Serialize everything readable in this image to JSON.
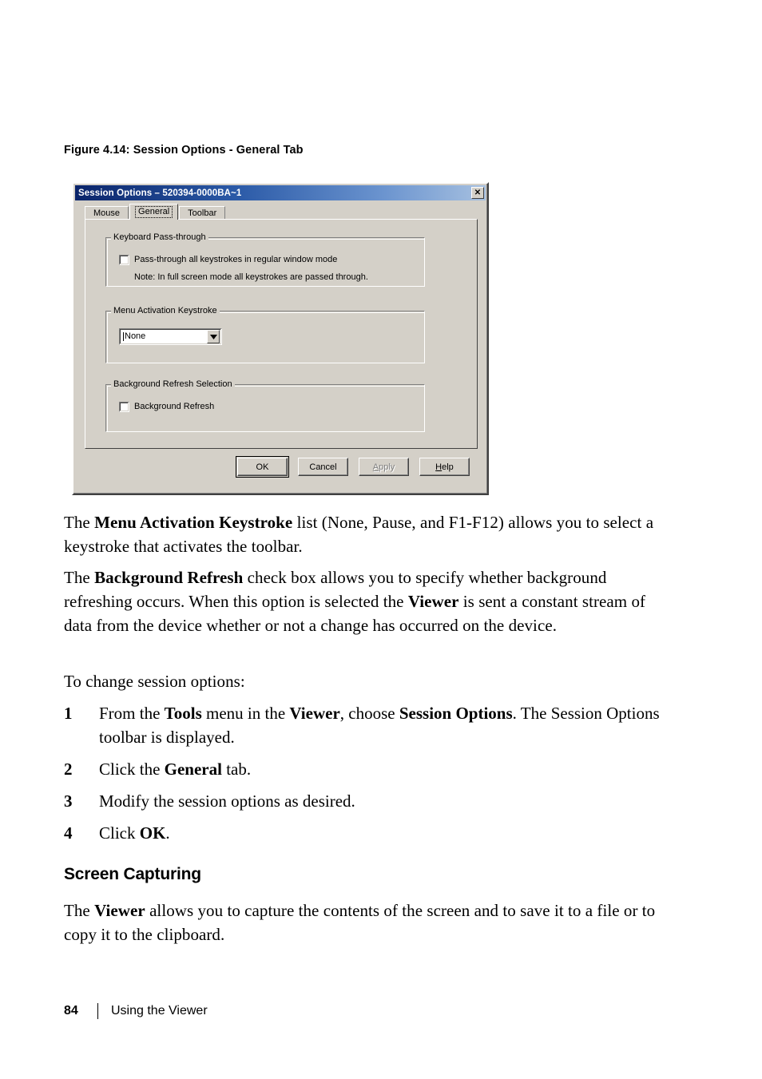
{
  "figure": {
    "caption": "Figure 4.14: Session Options - General Tab"
  },
  "dialog": {
    "title": "Session Options – 520394-0000BA~1",
    "close_label": "✕",
    "tabs": [
      {
        "label": "Mouse",
        "selected": false
      },
      {
        "label": "General",
        "selected": true
      },
      {
        "label": "Toolbar",
        "selected": false
      }
    ],
    "groups": {
      "keyboard_passthrough": {
        "title": "Keyboard Pass-through",
        "checkbox_label": "Pass-through all keystrokes in regular window mode",
        "checkbox_checked": false,
        "note": "Note: In full screen mode all keystrokes are passed through."
      },
      "menu_activation": {
        "title": "Menu Activation Keystroke",
        "selected_value": "None",
        "options": [
          "None",
          "Pause",
          "F1",
          "F2",
          "F3",
          "F4",
          "F5",
          "F6",
          "F7",
          "F8",
          "F9",
          "F10",
          "F11",
          "F12"
        ]
      },
      "background_refresh": {
        "title": "Background Refresh Selection",
        "checkbox_label": "Background Refresh",
        "checkbox_checked": false
      }
    },
    "buttons": {
      "ok": "OK",
      "cancel": "Cancel",
      "apply": "Apply",
      "apply_enabled": false,
      "help": "Help"
    },
    "colors": {
      "face": "#d4d0c8",
      "titlebar_start": "#0a246a",
      "titlebar_end": "#a6c0e0",
      "disabled_text": "#808080"
    }
  },
  "content": {
    "para1": {
      "pre": "The ",
      "bold1": "Menu Activation Keystroke",
      "post": " list (None, Pause, and F1-F12) allows you to select a keystroke that activates the toolbar."
    },
    "para2": {
      "pre": "The ",
      "bold1": "Background Refresh",
      "mid": " check box allows you to specify whether background refreshing occurs. When this option is selected the ",
      "bold2": "Viewer",
      "post": " is sent a constant stream of data from the device whether or not a change has occurred on the device."
    },
    "intro": "To change session options:",
    "steps": [
      {
        "num": "1",
        "pre": "From the ",
        "bold1": "Tools",
        "mid1": " menu in the ",
        "bold2": "Viewer",
        "mid2": ", choose ",
        "bold3": "Session Options",
        "post": ". The Session Options toolbar is displayed."
      },
      {
        "num": "2",
        "pre": "Click the ",
        "bold1": "General",
        "post": " tab."
      },
      {
        "num": "3",
        "pre": "Modify the session options as desired.",
        "bold1": "",
        "post": ""
      },
      {
        "num": "4",
        "pre": "Click ",
        "bold1": "OK",
        "post": "."
      }
    ],
    "heading": "Screen Capturing",
    "para3": {
      "pre": "The ",
      "bold1": "Viewer",
      "post": " allows you to capture the contents of the screen and to save it to a file or to copy it to the clipboard."
    }
  },
  "footer": {
    "page_number": "84",
    "chapter_label": "Using the Viewer"
  }
}
